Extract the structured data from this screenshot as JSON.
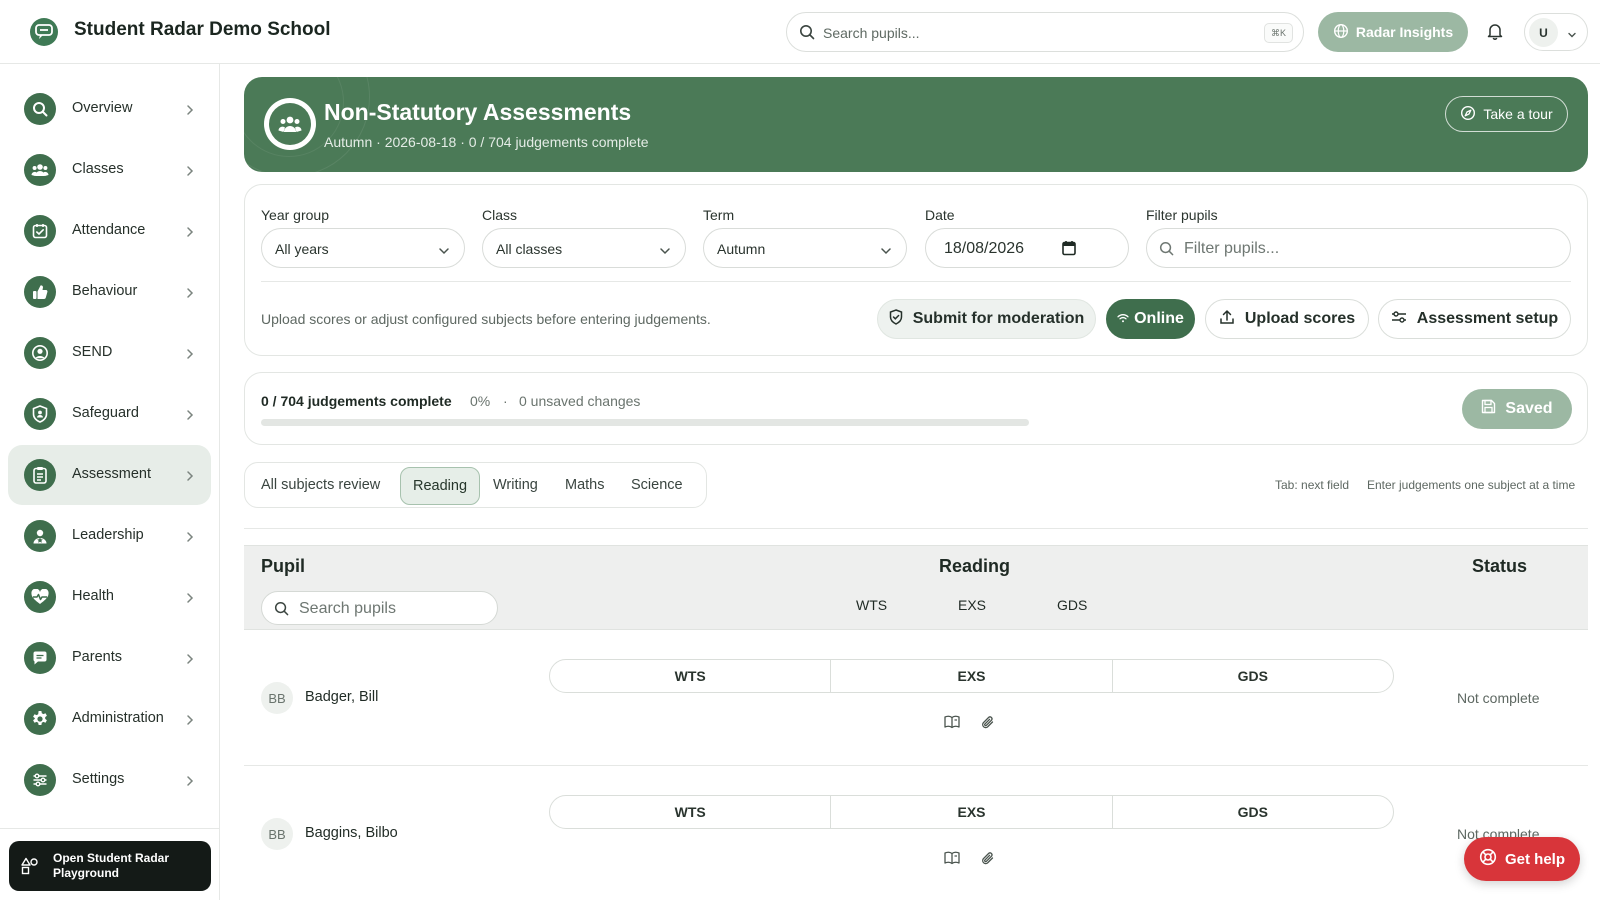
{
  "app": {
    "school_name": "Student Radar Demo School"
  },
  "topbar": {
    "search_placeholder": "Search pupils...",
    "search_shortcut": "⌘K",
    "insights_label": "Radar Insights",
    "user_initial": "U"
  },
  "sidebar": {
    "items": [
      {
        "label": "Overview",
        "icon": "search-icon"
      },
      {
        "label": "Classes",
        "icon": "users-icon"
      },
      {
        "label": "Attendance",
        "icon": "calendar-check-icon"
      },
      {
        "label": "Behaviour",
        "icon": "thumbs-up-icon"
      },
      {
        "label": "SEND",
        "icon": "user-circle-icon"
      },
      {
        "label": "Safeguard",
        "icon": "shield-icon"
      },
      {
        "label": "Assessment",
        "icon": "clipboard-icon",
        "active": true
      },
      {
        "label": "Leadership",
        "icon": "user-star-icon"
      },
      {
        "label": "Health",
        "icon": "heart-pulse-icon"
      },
      {
        "label": "Parents",
        "icon": "chat-icon"
      },
      {
        "label": "Administration",
        "icon": "gear-icon"
      },
      {
        "label": "Settings",
        "icon": "sliders-icon"
      }
    ],
    "playground_label": "Open Student Radar Playground"
  },
  "hero": {
    "title": "Non-Statutory Assessments",
    "subtitle": "Autumn · 2026-08-18 · 0 / 704 judgements complete",
    "tour_label": "Take a tour"
  },
  "filters": {
    "year_group": {
      "label": "Year group",
      "value": "All years"
    },
    "class": {
      "label": "Class",
      "value": "All classes"
    },
    "term": {
      "label": "Term",
      "value": "Autumn"
    },
    "date": {
      "label": "Date",
      "value": "18/08/2026"
    },
    "filter_pupils": {
      "label": "Filter pupils",
      "placeholder": "Filter pupils..."
    },
    "hint": "Upload scores or adjust configured subjects before entering judgements.",
    "actions": {
      "moderation": "Submit for moderation",
      "online": "Online",
      "upload": "Upload scores",
      "setup": "Assessment setup"
    }
  },
  "progress": {
    "summary": "0 / 704 judgements complete",
    "percent": "0%",
    "separator": "·",
    "unsaved": "0 unsaved changes",
    "fraction": 0,
    "saved_label": "Saved"
  },
  "tabs": {
    "items": [
      "All subjects review",
      "Reading",
      "Writing",
      "Maths",
      "Science"
    ],
    "active": "Reading",
    "hint_tab": "Tab: next field",
    "hint_enter": "Enter judgements one subject at a time"
  },
  "table": {
    "col_pupil": "Pupil",
    "col_subject": "Reading",
    "col_status": "Status",
    "search_placeholder": "Search pupils",
    "levels": [
      "WTS",
      "EXS",
      "GDS"
    ],
    "rows": [
      {
        "initials": "BB",
        "name": "Badger, Bill",
        "status": "Not complete"
      },
      {
        "initials": "BB",
        "name": "Baggins, Bilbo",
        "status": "Not complete"
      }
    ]
  },
  "help": {
    "label": "Get help"
  },
  "colors": {
    "brand": "#4b7a57",
    "brand_dark": "#3f6e4d",
    "muted_btn": "#9cb8a3",
    "help": "#d8353a"
  }
}
